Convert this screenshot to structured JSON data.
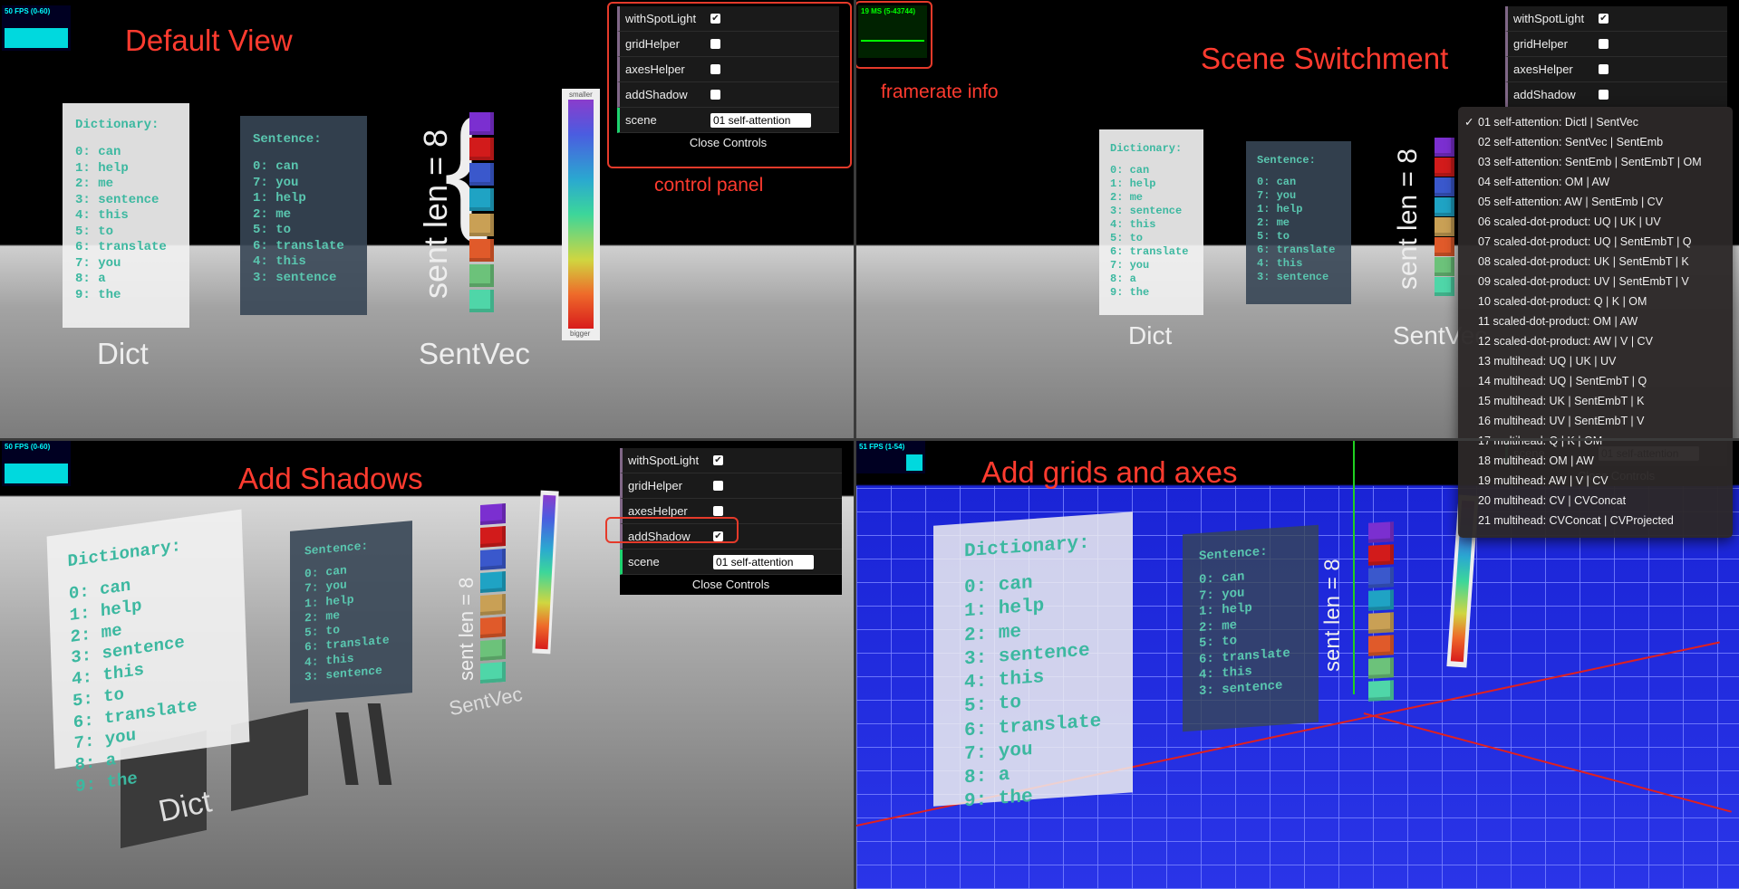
{
  "captions": {
    "default_view": "Default View",
    "scene_switchment": "Scene Switchment",
    "add_shadows": "Add Shadows",
    "add_grids_axes": "Add grids and axes",
    "framerate_info": "framerate info",
    "control_panel": "control panel"
  },
  "stats": {
    "q1_fps": "50 FPS (0-60)",
    "q2_ms": "19 MS (5-43744)",
    "q3_fps": "50 FPS (0-60)",
    "q4_fps": "51 FPS (1-54)"
  },
  "controls": {
    "with_spotlight": "withSpotLight",
    "grid_helper": "gridHelper",
    "axes_helper": "axesHelper",
    "add_shadow": "addShadow",
    "scene": "scene",
    "scene_value": "01 self-attention",
    "close": "Close Controls",
    "check": "✔"
  },
  "scene_cards": {
    "dict_title": "Dictionary:",
    "dict_lines": [
      "0: can",
      "1: help",
      "2: me",
      "3: sentence",
      "4: this",
      "5: to",
      "6: translate",
      "7: you",
      "8: a",
      "9: the"
    ],
    "sent_title": "Sentence:",
    "sent_lines": [
      "0: can",
      "7: you",
      "1: help",
      "2: me",
      "5: to",
      "6: translate",
      "4: this",
      "3: sentence"
    ],
    "dict_label": "Dict",
    "sentvec_label": "SentVec",
    "sent_len": "sent len = 8",
    "smaller": "smaller",
    "bigger": "bigger"
  },
  "scene_menu": [
    "01 self-attention: Dictl | SentVec",
    "02 self-attention: SentVec | SentEmb",
    "03 self-attention: SentEmb | SentEmbT | OM",
    "04 self-attention: OM | AW",
    "05 self-attention: AW | SentEmb | CV",
    "06 scaled-dot-product: UQ | UK | UV",
    "07 scaled-dot-product: UQ | SentEmbT | Q",
    "08 scaled-dot-product: UK | SentEmbT | K",
    "09 scaled-dot-product: UV | SentEmbT | V",
    "10 scaled-dot-product: Q | K | OM",
    "11 scaled-dot-product: OM | AW",
    "12 scaled-dot-product: AW | V | CV",
    "13 multihead: UQ | UK | UV",
    "14 multihead: UQ | SentEmbT | Q",
    "15 multihead: UK | SentEmbT | K",
    "16 multihead: UV | SentEmbT | V",
    "17 multihead: Q | K | OM",
    "18 multihead: OM | AW",
    "19 multihead: AW | V | CV",
    "20 multihead: CV | CVConcat",
    "21 multihead: CVConcat | CVProjected"
  ],
  "cube_colors": [
    "#7b2fd0",
    "#d21b1b",
    "#3a58cc",
    "#1fa3c4",
    "#c9a055",
    "#e05a2a",
    "#6cc27a",
    "#4fd6a8"
  ],
  "colors": {
    "accent_red": "#e53a2a",
    "caption_red": "#ff3b2f",
    "text_teal": "#3cb8a0"
  }
}
